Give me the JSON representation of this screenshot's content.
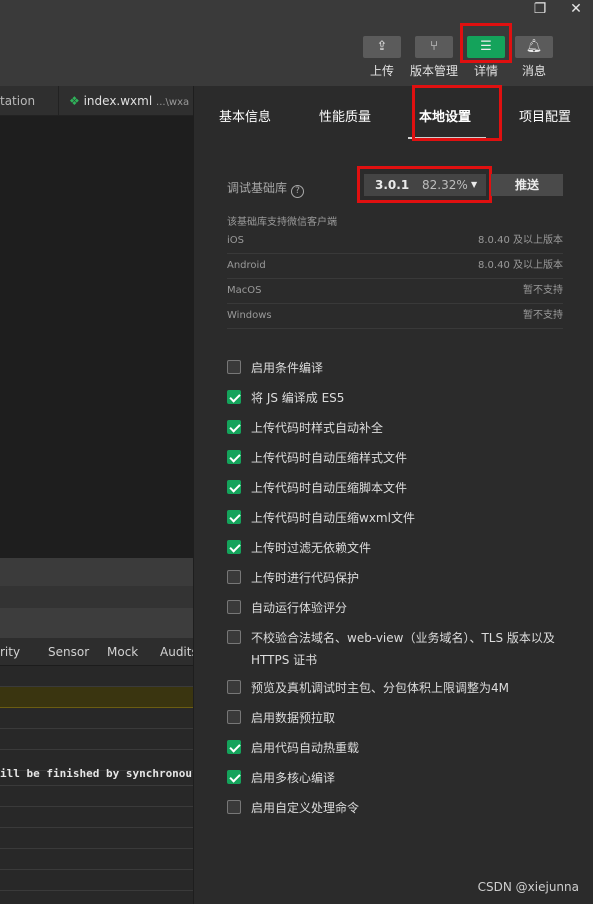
{
  "toolbar": {
    "upload_label": "上传",
    "version_label": "版本管理",
    "details_label": "详情",
    "messages_label": "消息",
    "accent_color": "#14a35b"
  },
  "window_controls": {
    "restore_icon": "restore-icon",
    "close_icon": "close-icon"
  },
  "file_tabs": {
    "tab1_label": "tation",
    "tab2_label": "index.wxml",
    "tab2_path": "...\\wxa"
  },
  "devtools_tabs": [
    "rity",
    "Sensor",
    "Mock",
    "Audits"
  ],
  "console": {
    "line_text": "ill be finished by synchronous"
  },
  "settings": {
    "tabs": [
      "基本信息",
      "性能质量",
      "本地设置",
      "项目配置"
    ],
    "active_tab": "本地设置",
    "debug_lib_label": "调试基础库",
    "version": "3.0.1",
    "version_percent": "82.32%",
    "push_label": "推送",
    "support_note": "该基础库支持微信客户端",
    "platforms": [
      {
        "name": "iOS",
        "value": "8.0.40 及以上版本"
      },
      {
        "name": "Android",
        "value": "8.0.40 及以上版本"
      },
      {
        "name": "MacOS",
        "value": "暂不支持"
      },
      {
        "name": "Windows",
        "value": "暂不支持"
      }
    ],
    "options": [
      {
        "label": "启用条件编译",
        "checked": false
      },
      {
        "label": "将 JS 编译成 ES5",
        "checked": true
      },
      {
        "label": "上传代码时样式自动补全",
        "checked": true
      },
      {
        "label": "上传代码时自动压缩样式文件",
        "checked": true
      },
      {
        "label": "上传代码时自动压缩脚本文件",
        "checked": true
      },
      {
        "label": "上传代码时自动压缩wxml文件",
        "checked": true
      },
      {
        "label": "上传时过滤无依赖文件",
        "checked": true
      },
      {
        "label": "上传时进行代码保护",
        "checked": false
      },
      {
        "label": "自动运行体验评分",
        "checked": false
      },
      {
        "label": "不校验合法域名、web-view（业务域名）、TLS 版本以及 HTTPS 证书",
        "checked": false
      },
      {
        "label": "预览及真机调试时主包、分包体积上限调整为4M",
        "checked": false
      },
      {
        "label": "启用数据预拉取",
        "checked": false
      },
      {
        "label": "启用代码自动热重载",
        "checked": true
      },
      {
        "label": "启用多核心编译",
        "checked": true
      },
      {
        "label": "启用自定义处理命令",
        "checked": false
      }
    ]
  },
  "watermark": "CSDN @xiejunna"
}
